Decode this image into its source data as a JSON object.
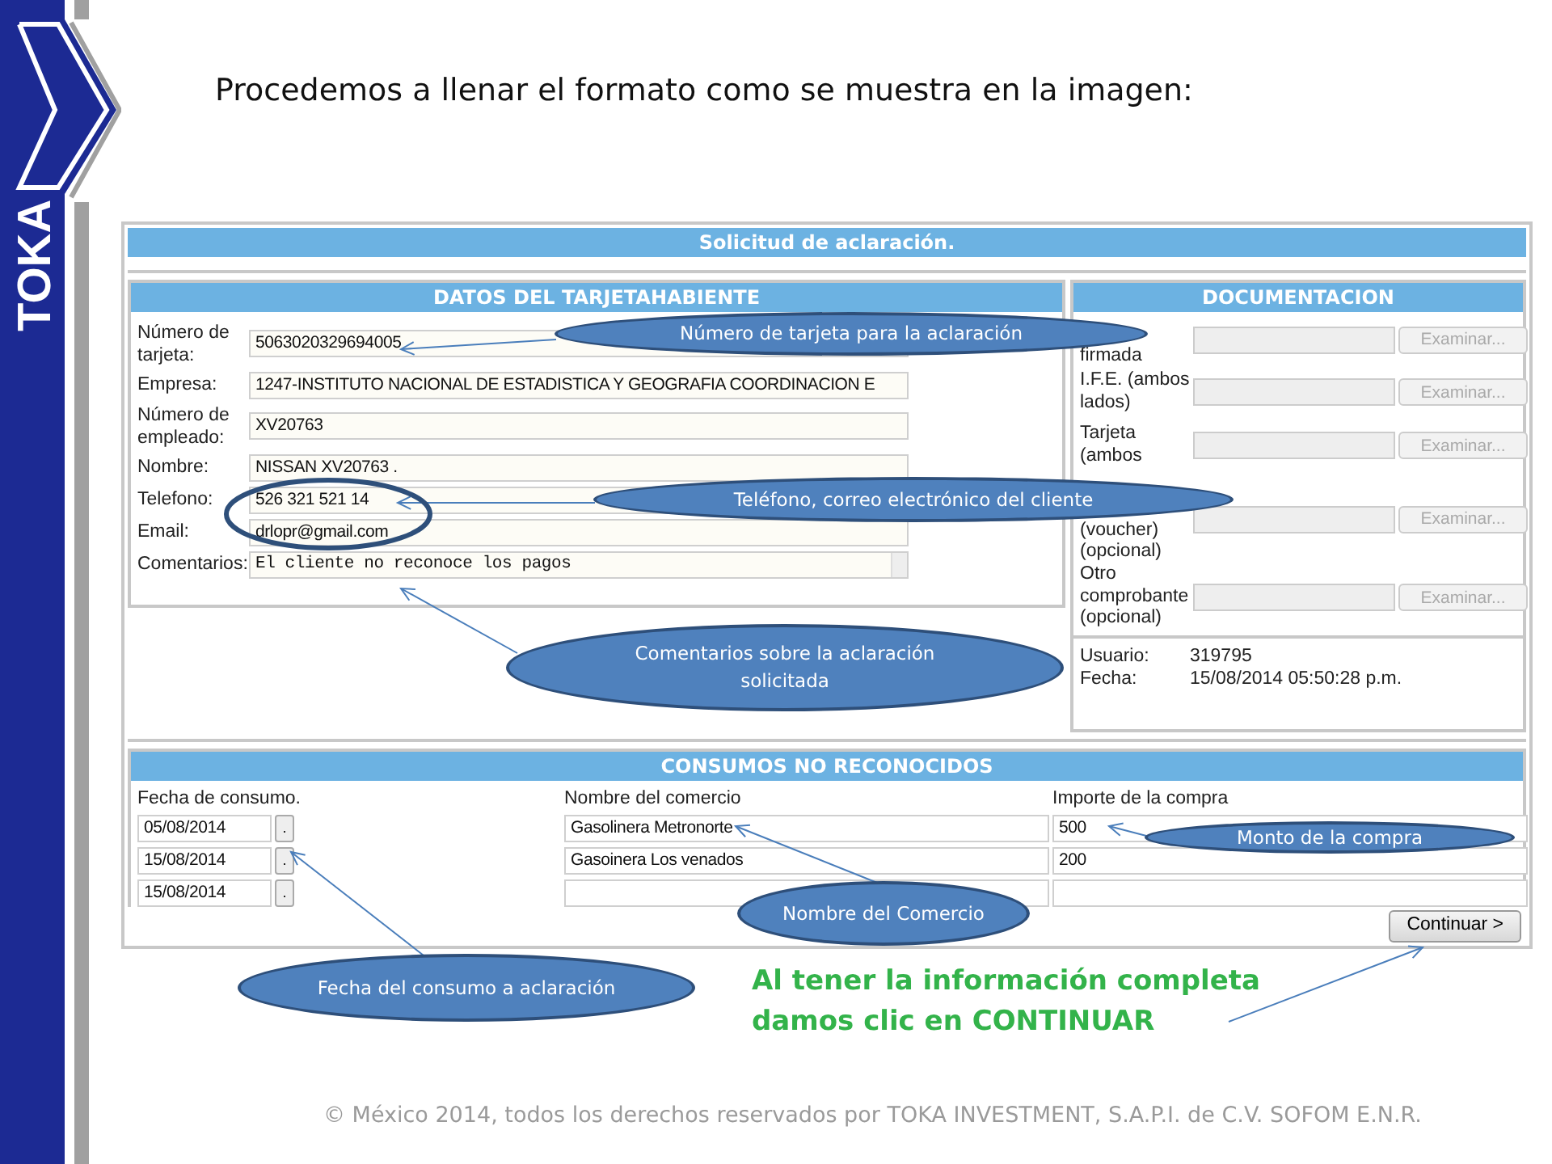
{
  "slide": {
    "logo": "TOKA",
    "title": "Procedemos a llenar el formato como se muestra en la imagen:"
  },
  "form": {
    "title": "Solicitud de aclaración.",
    "cardholder": {
      "heading": "DATOS DEL TARJETAHABIENTE",
      "fields": [
        {
          "label": "Número de tarjeta:",
          "value": "5063020329694005",
          "kind": "input"
        },
        {
          "label": "Empresa:",
          "value": "1247-INSTITUTO NACIONAL DE ESTADISTICA Y GEOGRAFIA COORDINACION E",
          "kind": "input"
        },
        {
          "label": "Número de empleado:",
          "value": "XV20763",
          "kind": "input"
        },
        {
          "label": "Nombre:",
          "value": "NISSAN XV20763 .",
          "kind": "input"
        },
        {
          "label": "Telefono:",
          "value": "526 321 521 14",
          "kind": "input"
        },
        {
          "label": "Email:",
          "value": "drlopr@gmail.com",
          "kind": "input"
        },
        {
          "label": "Comentarios:",
          "value": "El cliente no reconoce los pagos",
          "kind": "textarea"
        }
      ]
    },
    "documents": {
      "heading": "DOCUMENTACION",
      "rows": [
        {
          "label": "firmada",
          "button": "Examinar...",
          "disabled": true
        },
        {
          "label": "I.F.E. (ambos lados)",
          "button": "Examinar...",
          "disabled": true
        },
        {
          "label": "Tarjeta (ambos",
          "button": "Examinar...",
          "disabled": true
        },
        {
          "label": "(voucher) (opcional)",
          "button": "Examinar...",
          "disabled": true
        },
        {
          "label": "Otro comprobante (opcional)",
          "button": "Examinar...",
          "disabled": true
        }
      ],
      "info": [
        {
          "label": "Usuario:",
          "value": "319795"
        },
        {
          "label": "Fecha:",
          "value": "15/08/2014 05:50:28 p.m."
        }
      ]
    },
    "purchases": {
      "heading": "CONSUMOS NO RECONOCIDOS",
      "columns": [
        "Fecha de consumo.",
        "Nombre del comercio",
        "Importe de la compra"
      ],
      "rows": [
        {
          "date": "05/08/2014",
          "picker": ".",
          "merchant": "Gasolinera Metronorte",
          "amount": "500"
        },
        {
          "date": "15/08/2014",
          "picker": ".",
          "merchant": "Gasoinera Los venados",
          "amount": "200"
        },
        {
          "date": "15/08/2014",
          "picker": "."
        }
      ]
    },
    "continue_button": "Continuar >"
  },
  "callouts": [
    {
      "text": "Número de tarjeta para la aclaración"
    },
    {
      "text": "Teléfono, correo electrónico del cliente"
    },
    {
      "text": "Comentarios sobre la aclaración solicitada"
    },
    {
      "text": "Monto de la compra"
    },
    {
      "text": "Nombre del Comercio"
    },
    {
      "text": "Fecha del consumo a aclaración"
    }
  ],
  "note": "Al tener la información completa damos clic en CONTINUAR",
  "footer": "© México 2014, todos los derechos reservados por TOKA INVESTMENT, S.A.P.I. de C.V. SOFOM E.N.R."
}
